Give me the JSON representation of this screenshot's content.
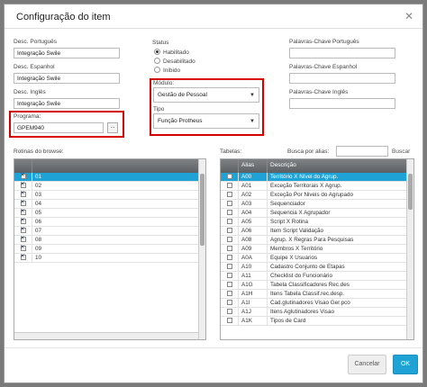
{
  "dialog": {
    "title": "Configuração do item",
    "close": "✕"
  },
  "form": {
    "desc_pt_label": "Desc. Português",
    "desc_pt_value": "Integração Swile",
    "desc_es_label": "Desc. Espanhol",
    "desc_es_value": "Integração Swile",
    "desc_en_label": "Desc. Inglês",
    "desc_en_value": "Integração Swile",
    "programa_label": "Programa:",
    "programa_value": "GPEM940",
    "lookup": "...",
    "status_label": "Status",
    "status_options": [
      "Habilitado",
      "Desabilitado",
      "Inibido"
    ],
    "modulo_label": "Módulo:",
    "modulo_value": "Gestão de Pessoal",
    "tipo_label": "Tipo",
    "tipo_value": "Função Protheus",
    "kw_pt_label": "Palavras-Chave Português",
    "kw_es_label": "Palavras-Chave Espanhol",
    "kw_en_label": "Palavras-Chave Inglês"
  },
  "rotinas": {
    "label": "Rotinas do browse:",
    "rows": [
      "01",
      "02",
      "03",
      "04",
      "05",
      "06",
      "07",
      "08",
      "09",
      "10"
    ]
  },
  "tabelas": {
    "label": "Tabelas:",
    "search_label": "Busca por alias:",
    "search_button": "Buscar",
    "col_alias": "Alias",
    "col_desc": "Descrição",
    "rows": [
      {
        "alias": "A00",
        "desc": "Território X Nível do Agrup."
      },
      {
        "alias": "A01",
        "desc": "Exceção Territorais X Agrup."
      },
      {
        "alias": "A02",
        "desc": "Exceção Por Niveis do Agrupado"
      },
      {
        "alias": "A03",
        "desc": "Sequenciador"
      },
      {
        "alias": "A04",
        "desc": "Sequencia X Agrupador"
      },
      {
        "alias": "A05",
        "desc": "Script X Rotina"
      },
      {
        "alias": "A06",
        "desc": "Item Script Validação"
      },
      {
        "alias": "A08",
        "desc": "Agrup. X Regras Para Pesquisas"
      },
      {
        "alias": "A09",
        "desc": "Membros X Território"
      },
      {
        "alias": "A0A",
        "desc": "Equipe X Usuarios"
      },
      {
        "alias": "A10",
        "desc": "Cadastro Conjunto de Etapas"
      },
      {
        "alias": "A11",
        "desc": "Checklist do Funcionário"
      },
      {
        "alias": "A1G",
        "desc": "Tabela Classificadores Rec.des"
      },
      {
        "alias": "A1H",
        "desc": "Itens Tabela Classif.rec.desp."
      },
      {
        "alias": "A1I",
        "desc": "Cad.glutinadores Visao Ger.pco"
      },
      {
        "alias": "A1J",
        "desc": "Itens Aglutinadores Visao"
      },
      {
        "alias": "A1K",
        "desc": "Tipos de Card"
      }
    ]
  },
  "buttons": {
    "cancel": "Cancelar",
    "ok": "OK"
  }
}
